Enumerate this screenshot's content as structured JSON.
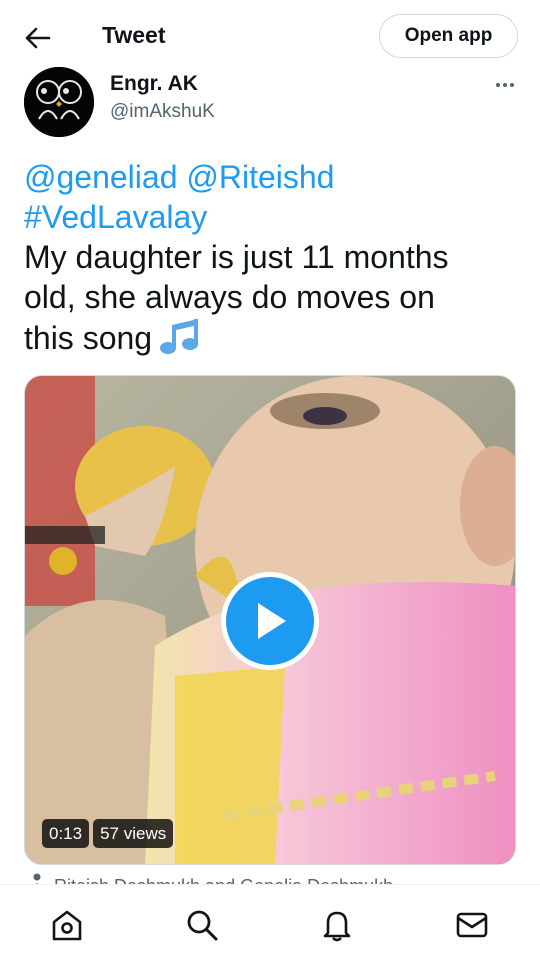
{
  "header": {
    "title": "Tweet",
    "open_app_label": "Open app"
  },
  "author": {
    "name": "Engr. AK",
    "handle": "@imAkshuK"
  },
  "tweet": {
    "mentions": "@geneliad @Riteishd",
    "hashtag": "#VedLavalay",
    "body_line1": "My daughter is just 11 months",
    "body_line2": "old, she always do moves on",
    "body_line3": "this song",
    "emoji_icon": "musical-notes-icon"
  },
  "media": {
    "duration": "0:13",
    "views": "57 views",
    "accent_color": "#1d9bf0"
  },
  "tagged_people": "Riteish Deshmukh and Genelia Deshmukh",
  "nav": {
    "items": [
      "home-icon",
      "search-icon",
      "notifications-icon",
      "messages-icon"
    ]
  },
  "colors": {
    "link": "#1d9bf0",
    "text": "#0f1419",
    "secondary": "#536471"
  }
}
